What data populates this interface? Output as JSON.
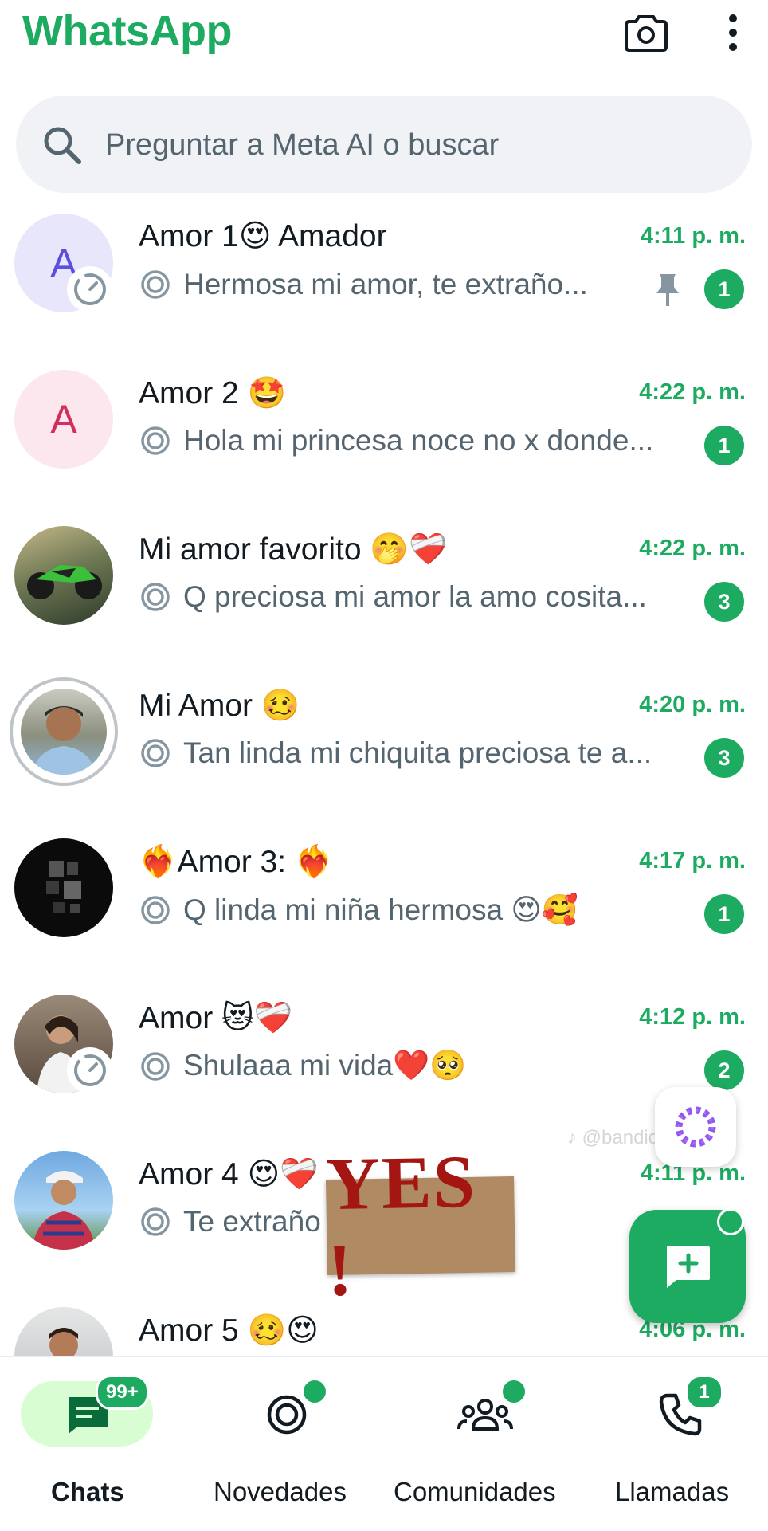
{
  "app": {
    "title": "WhatsApp"
  },
  "toolbar": {
    "camera_icon": "camera-icon",
    "menu_icon": "more-vertical-icon"
  },
  "search": {
    "placeholder": "Preguntar a Meta AI o buscar",
    "value": ""
  },
  "chats": [
    {
      "name": "Amor 1😍 Amador",
      "time": "4:11 p. m.",
      "preview": "Hermosa mi amor,  te extraño...",
      "unread": "1",
      "pinned": true,
      "avatar_letter": "A"
    },
    {
      "name": "Amor 2 🤩",
      "time": "4:22 p. m.",
      "preview": "Hola mi princesa noce no x donde...",
      "unread": "1",
      "avatar_letter": "A"
    },
    {
      "name": "Mi amor favorito 🤭❤️‍🩹",
      "time": "4:22 p. m.",
      "preview": "Q preciosa mi amor la amo cosita...",
      "unread": "3"
    },
    {
      "name": "Mi Amor 🥴",
      "time": "4:20 p. m.",
      "preview": "Tan linda mi chiquita preciosa te a...",
      "unread": "3"
    },
    {
      "name": "❤️‍🔥Amor 3: ❤️‍🔥",
      "time": "4:17 p. m.",
      "preview": "Q linda mi niña hermosa 😍🥰",
      "unread": "1"
    },
    {
      "name": "Amor 😻❤️‍🩹",
      "time": "4:12 p. m.",
      "preview": "Shulaaa mi vida❤️🥺",
      "unread": "2"
    },
    {
      "name": "Amor 4 😍❤️‍🩹",
      "time": "4:11 p. m.",
      "preview": "Te extraño",
      "unread": ""
    },
    {
      "name": "Amor 5 🥴😍",
      "time": "4:06 p. m.",
      "preview": "",
      "unread": ""
    }
  ],
  "overlay": {
    "sticker_text": "YES !",
    "watermark": "♪ @bandidarubia24"
  },
  "bottom_nav": [
    {
      "label": "Chats",
      "badge": "99+",
      "icon": "chats-icon",
      "active": true
    },
    {
      "label": "Novedades",
      "icon": "updates-icon"
    },
    {
      "label": "Comunidades",
      "icon": "communities-icon"
    },
    {
      "label": "Llamadas",
      "badge": "1",
      "icon": "calls-icon"
    }
  ],
  "colors": {
    "accent": "#1daa61",
    "pill": "#d8fdd2",
    "secondary_text": "#54656f"
  }
}
